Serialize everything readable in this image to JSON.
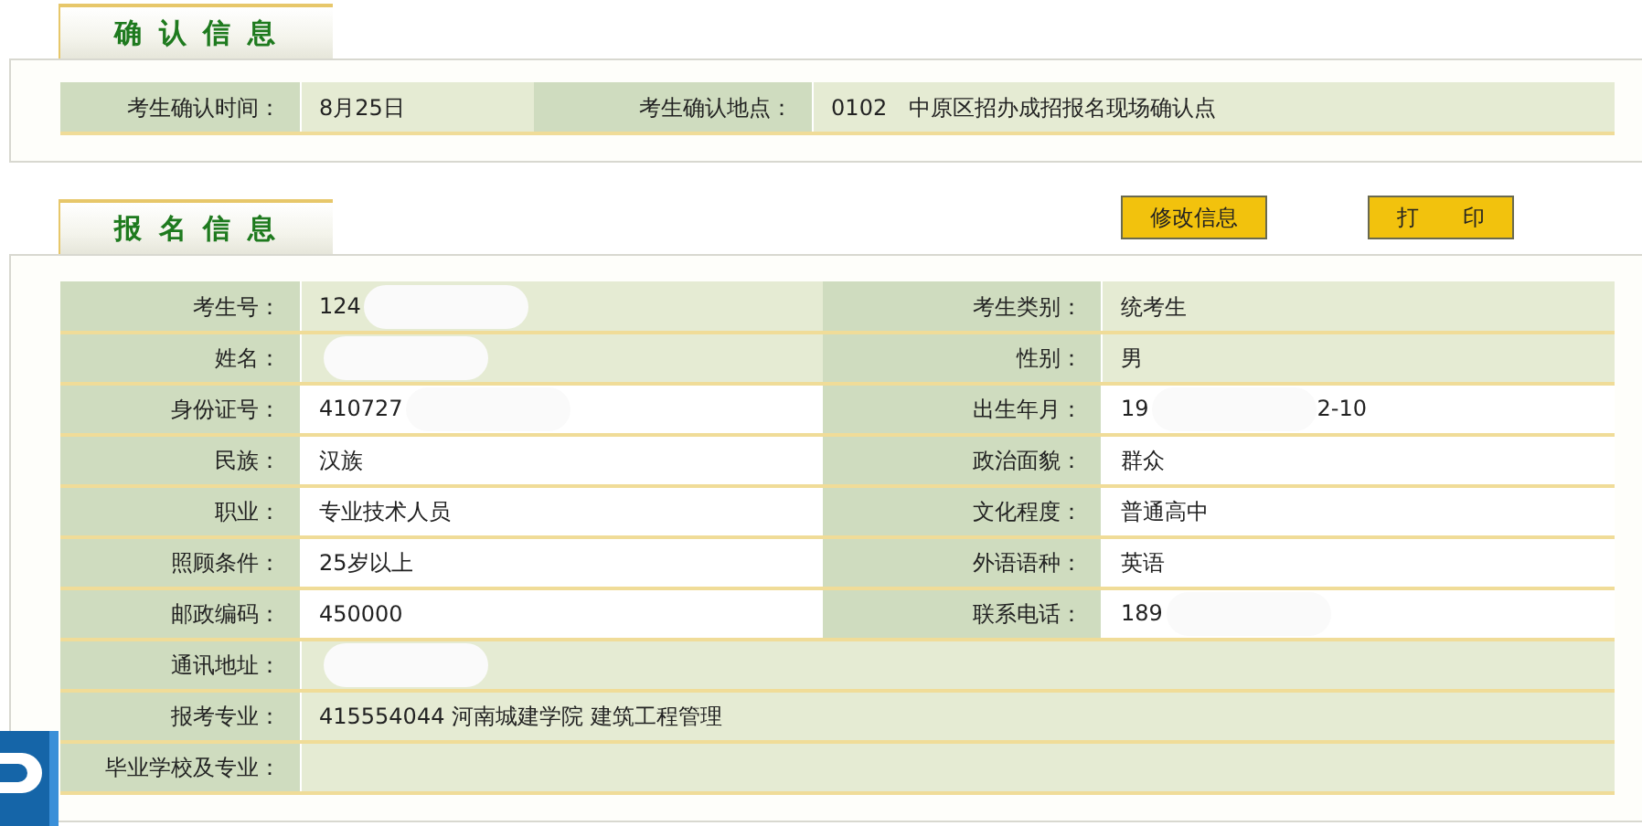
{
  "confirm_section": {
    "title": "确 认 信 息",
    "rows": [
      {
        "kind": "pair",
        "cells": [
          {
            "label": "考生确认时间：",
            "value": "8月25日"
          },
          {
            "label": "考生确认地点：",
            "value": "0102　中原区招办成招报名现场确认点"
          }
        ]
      }
    ]
  },
  "registration_section": {
    "title": "报 名 信 息",
    "buttons": [
      "修改信息",
      "打　　印"
    ],
    "rows": [
      {
        "kind": "pair",
        "white": false,
        "cells": [
          {
            "label": "考生号：",
            "value": "124",
            "redacted": true
          },
          {
            "label": "考生类别：",
            "value": "统考生"
          }
        ]
      },
      {
        "kind": "pair",
        "white": false,
        "cells": [
          {
            "label": "姓名：",
            "redacted": true
          },
          {
            "label": "性别：",
            "value": "男"
          }
        ]
      },
      {
        "kind": "pair",
        "white": true,
        "cells": [
          {
            "label": "身份证号：",
            "value": "410727",
            "redacted": true
          },
          {
            "label": "出生年月：",
            "value": "19",
            "redacted": true,
            "value_tail": "2-10"
          }
        ]
      },
      {
        "kind": "pair",
        "white": true,
        "cells": [
          {
            "label": "民族：",
            "value": "汉族"
          },
          {
            "label": "政治面貌：",
            "value": "群众"
          }
        ]
      },
      {
        "kind": "pair",
        "white": true,
        "cells": [
          {
            "label": "职业：",
            "value": "专业技术人员"
          },
          {
            "label": "文化程度：",
            "value": "普通高中"
          }
        ]
      },
      {
        "kind": "pair",
        "white": true,
        "cells": [
          {
            "label": "照顾条件：",
            "value": "25岁以上"
          },
          {
            "label": "外语语种：",
            "value": "英语"
          }
        ]
      },
      {
        "kind": "pair",
        "white": true,
        "cells": [
          {
            "label": "邮政编码：",
            "value": "450000"
          },
          {
            "label": "联系电话：",
            "value": "189",
            "redacted": true
          }
        ]
      },
      {
        "kind": "wide",
        "white": false,
        "cells": [
          {
            "label": "通讯地址：",
            "redacted": true
          }
        ]
      },
      {
        "kind": "wide",
        "white": false,
        "cells": [
          {
            "label": "报考专业：",
            "value": "415554044  河南城建学院  建筑工程管理"
          }
        ]
      },
      {
        "kind": "wide",
        "white": false,
        "cells": [
          {
            "label": "毕业学校及专业："
          }
        ]
      }
    ]
  }
}
